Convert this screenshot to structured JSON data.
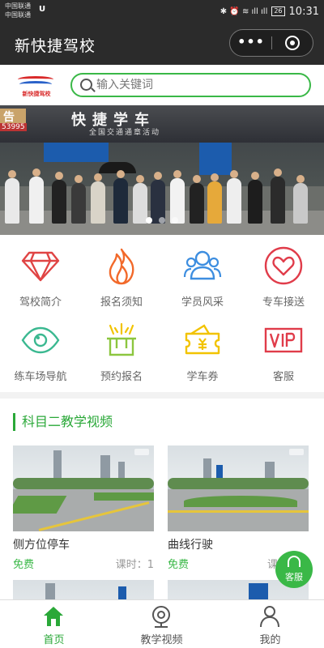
{
  "status_bar": {
    "carrier_1": "中国联通",
    "carrier_2": "中国联通",
    "carrier_icon": "U",
    "icons": "✱ ⏰ ≋ ıll ıll",
    "battery": "26",
    "time": "10:31"
  },
  "title_bar": {
    "title": "新快捷驾校",
    "more_icon": "•••"
  },
  "header": {
    "logo_text": "新快捷驾校",
    "search_placeholder": "输入关键词"
  },
  "banner": {
    "sign_text": "快捷学车",
    "sign_sub": "全国交通通章活动",
    "sign_left": "告",
    "phone_fragment": "53995",
    "slide_count": 3,
    "active_slide": 1
  },
  "icon_grid": [
    {
      "name": "diamond-icon",
      "label": "驾校简介",
      "color": "#e04444"
    },
    {
      "name": "flame-icon",
      "label": "报名须知",
      "color": "#f2692a"
    },
    {
      "name": "users-icon",
      "label": "学员风采",
      "color": "#3d8ee0"
    },
    {
      "name": "heart-icon",
      "label": "专车接送",
      "color": "#e03c4a"
    },
    {
      "name": "eye-icon",
      "label": "练车场导航",
      "color": "#3ab890"
    },
    {
      "name": "gift-pot-icon",
      "label": "预约报名",
      "color": "#8cc63f"
    },
    {
      "name": "ticket-icon",
      "label": "学车券",
      "color": "#f2c300"
    },
    {
      "name": "vip-icon",
      "label": "客服",
      "color": "#e03c4a"
    }
  ],
  "videos": {
    "section_title": "科目二教学视频",
    "items": [
      {
        "title": "侧方位停车",
        "price": "免费",
        "hours": "课时：1"
      },
      {
        "title": "曲线行驶",
        "price": "免费",
        "hours": "课"
      }
    ]
  },
  "floating_button": {
    "label": "客服"
  },
  "tabbar": {
    "active_color": "#2aa838",
    "items": [
      {
        "label": "首页",
        "icon": "home-icon"
      },
      {
        "label": "教学视频",
        "icon": "camera-icon"
      },
      {
        "label": "我的",
        "icon": "user-icon"
      }
    ]
  }
}
